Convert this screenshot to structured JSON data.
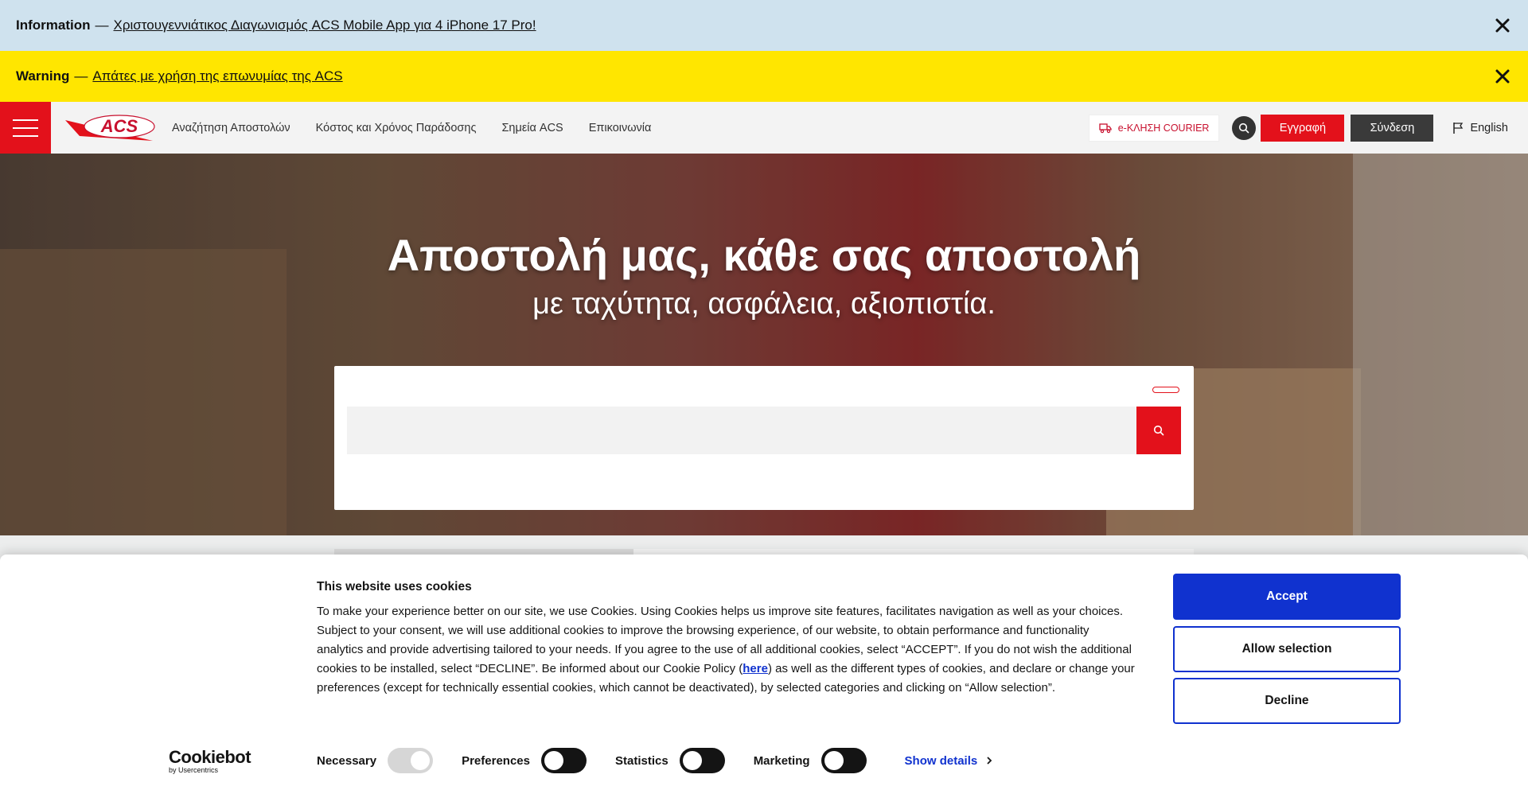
{
  "banners": {
    "info": {
      "kind": "Information",
      "dash": "—",
      "message": "Χριστουγεννιάτικος Διαγωνισμός ACS Mobile App για 4 iPhone 17 Pro!"
    },
    "warning": {
      "kind": "Warning",
      "dash": "—",
      "message": "Απάτες με χρήση της επωνυμίας της ACS"
    }
  },
  "header": {
    "logo_text": "ACS",
    "nav": [
      "Αναζήτηση Αποστολών",
      "Κόστος και Χρόνος Παράδοσης",
      "Σημεία ACS",
      "Επικοινωνία"
    ],
    "courier_label": "e-ΚΛΗΣΗ COURIER",
    "register_label": "Εγγραφή",
    "login_label": "Σύνδεση",
    "language_label": "English"
  },
  "hero": {
    "title": "Αποστολή μας, κάθε σας αποστολή",
    "subtitle": "με ταχύτητα, ασφάλεια, αξιοπιστία.",
    "search_value": ""
  },
  "cookie": {
    "title": "This website uses cookies",
    "text_before_link": "To make your experience better on our site, we use Cookies. Using Cookies helps us improve site features, facilitates navigation as well as your choices. Subject to your consent, we will use additional cookies to improve the browsing experience, of our website, to obtain performance and functionality analytics and provide advertising tailored to your needs. If you agree to the use of all additional cookies, select “ACCEPT”. If you do not wish the additional cookies to be installed, select “DECLINE”. Be informed about our Cookie Policy (",
    "link_text": "here",
    "text_after_link": ") as well as the different types of cookies, and declare or change your preferences (except for technically essential cookies, which cannot be deactivated), by selected categories and clicking on “Allow selection”.",
    "accept_label": "Accept",
    "allow_selection_label": "Allow selection",
    "decline_label": "Decline",
    "brand_name": "Cookiebot",
    "brand_sub": "by Usercentrics",
    "toggles": [
      {
        "label": "Necessary",
        "state": "on-locked"
      },
      {
        "label": "Preferences",
        "state": "off"
      },
      {
        "label": "Statistics",
        "state": "off"
      },
      {
        "label": "Marketing",
        "state": "off"
      }
    ],
    "show_details_label": "Show details"
  },
  "colors": {
    "brand_red": "#e3111b",
    "info_bg": "#cfe2ee",
    "warning_bg": "#ffe600",
    "cookie_blue": "#1032cf"
  }
}
